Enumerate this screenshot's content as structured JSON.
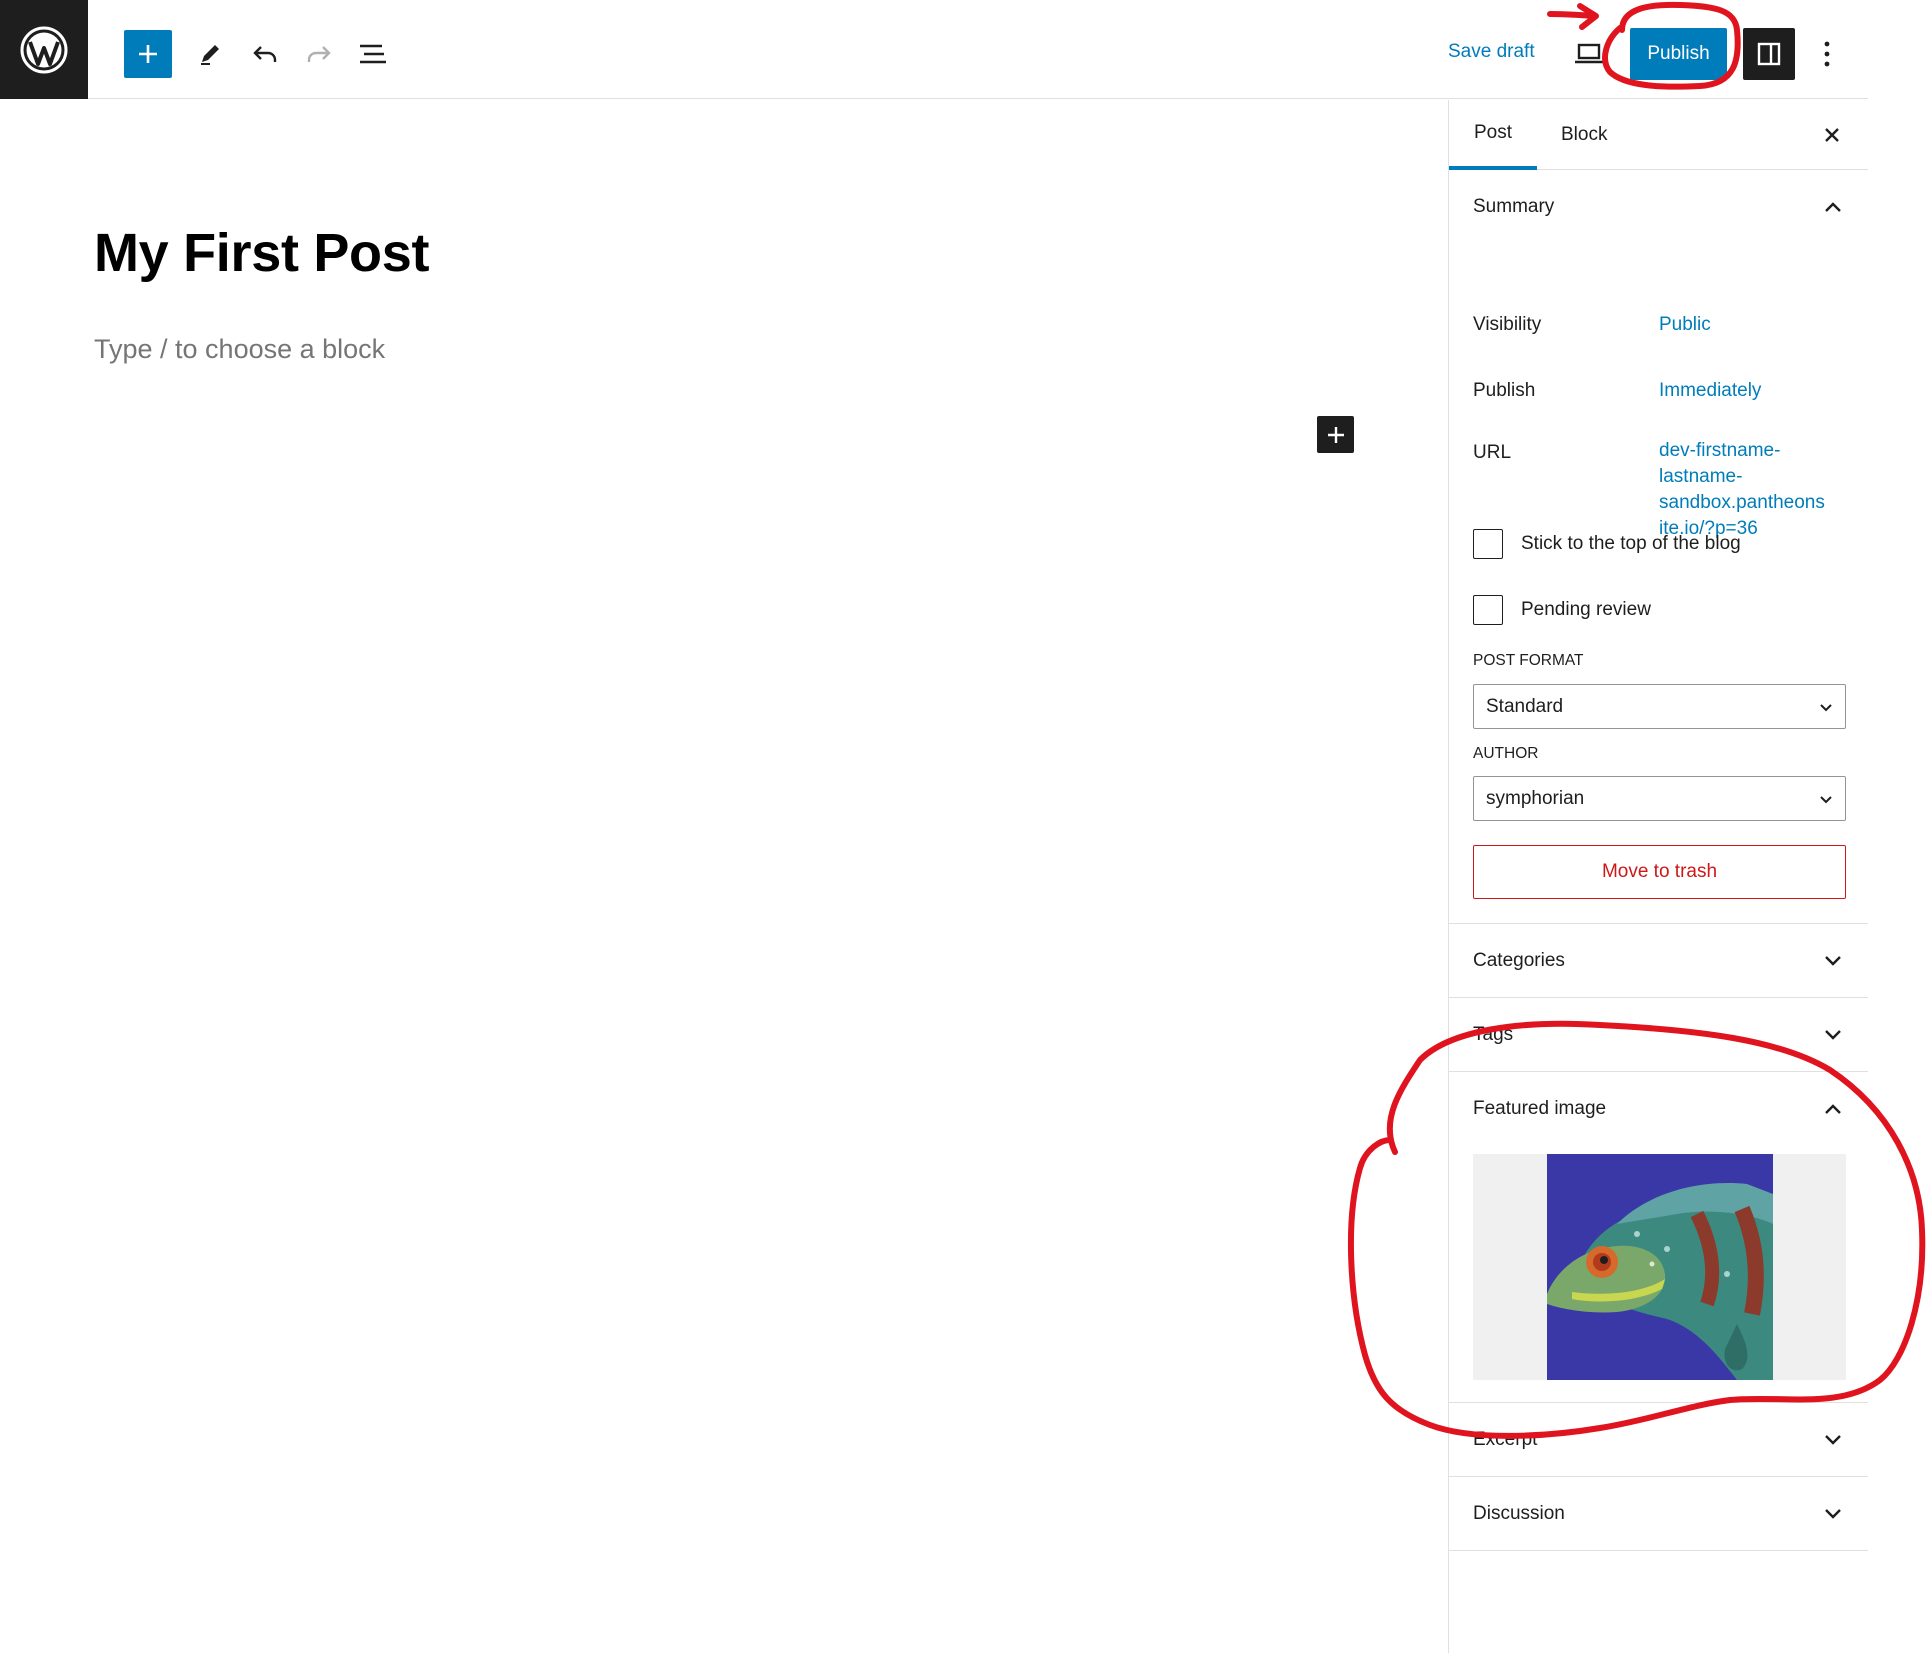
{
  "header": {
    "save_draft": "Save draft",
    "publish": "Publish"
  },
  "editor": {
    "title": "My First Post",
    "placeholder": "Type / to choose a block"
  },
  "sidebar": {
    "tabs": {
      "post": "Post",
      "block": "Block"
    },
    "summary": {
      "title": "Summary",
      "visibility_label": "Visibility",
      "visibility_value": "Public",
      "publish_label": "Publish",
      "publish_value": "Immediately",
      "url_label": "URL",
      "url_value_lines": [
        "dev-firstname-",
        "lastname-",
        "sandbox.pantheons",
        "ite.io/?p=36"
      ],
      "sticky_label": "Stick to the top of the blog",
      "pending_label": "Pending review",
      "post_format_label": "POST FORMAT",
      "post_format_value": "Standard",
      "author_label": "AUTHOR",
      "author_value": "symphorian",
      "trash_label": "Move to trash"
    },
    "panels": {
      "categories": "Categories",
      "tags": "Tags",
      "featured_image": "Featured image",
      "excerpt": "Excerpt",
      "discussion": "Discussion"
    }
  },
  "colors": {
    "accent": "#007cba",
    "dark": "#1e1e1e",
    "danger": "#cc1818",
    "annotation": "#e0141e"
  }
}
